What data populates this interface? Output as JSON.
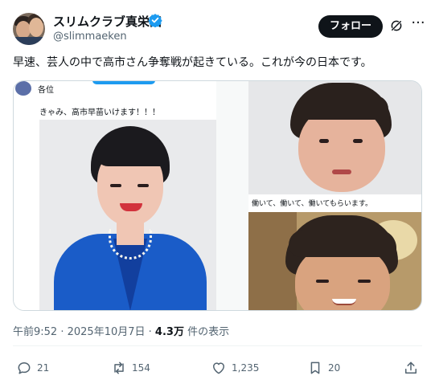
{
  "author": {
    "display_name": "スリムクラブ真栄田",
    "handle": "@slimmaeken",
    "verified": true
  },
  "header": {
    "follow_label": "フォロー",
    "grok_icon": "grok-slash-icon",
    "more_icon": "more-horizontal-icon"
  },
  "tweet": {
    "text": "早速、芸人の中で高市さん争奪戦が起きている。これが今の日本です。"
  },
  "media": {
    "left": {
      "greeting": "各位",
      "message": "きゃみ、高市早苗いけます！！！"
    },
    "right_middle": {
      "caption": "働いて、働いて、働いてもらいます。"
    }
  },
  "meta": {
    "time": "午前9:52",
    "separator": " · ",
    "date": "2025年10月7日",
    "views_count": "4.3万",
    "views_label": " 件の表示"
  },
  "actions": {
    "replies": "21",
    "reposts": "154",
    "likes": "1,235",
    "bookmarks": "20"
  },
  "colors": {
    "verified_blue": "#1d9bf0",
    "text_primary": "#0f1419",
    "text_secondary": "#536471",
    "follow_bg": "#0f1419"
  }
}
